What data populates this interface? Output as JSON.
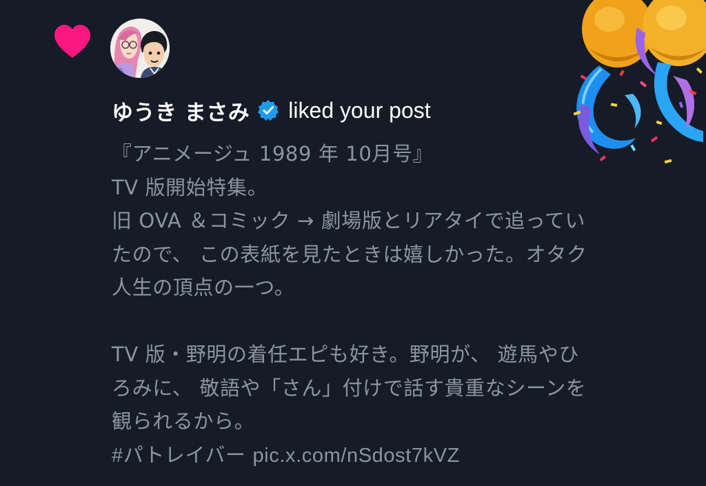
{
  "notification": {
    "type_icon": "heart-icon",
    "accent_color": "#f91880",
    "background_color": "#151b27",
    "user": {
      "name": "ゆうき まさみ",
      "verified": true,
      "verified_icon": "verified-badge-icon",
      "verified_color": "#1d9bf0",
      "avatar_icon": "avatar"
    },
    "action_text": "liked your post",
    "post": {
      "lines": [
        "『アニメージュ 1989 年 10月号』",
        "TV 版開始特集。",
        "旧 OVA ＆コミック → 劇場版とリアタイで追ってい",
        "たので、 この表紙を見たときは嬉しかった。オタク",
        "人生の頂点の一つ。",
        "",
        "TV 版・野明の着任エピも好き。野明が、 遊馬やひ",
        "ろみに、 敬語や「さん」付けで話す貴重なシーンを",
        "観られるから。"
      ],
      "hashtag": "#パトレイバー",
      "link": "pic.x.com/nSdost7kVZ"
    },
    "decoration_icon": "confetti-balloon-icon"
  }
}
